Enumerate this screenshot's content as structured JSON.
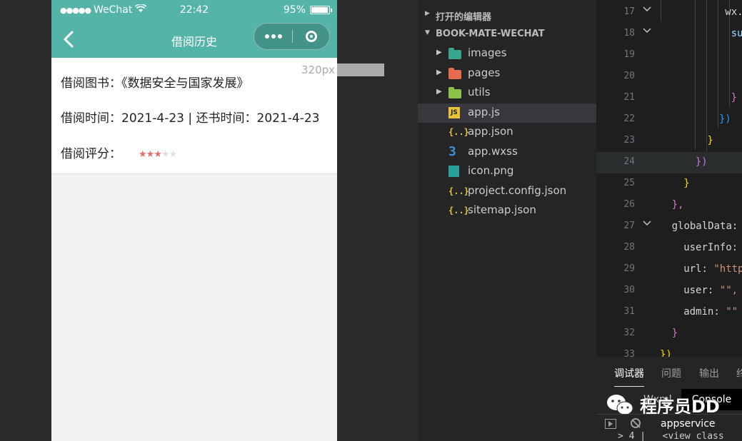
{
  "simulator": {
    "status_bar": {
      "signal": "●●●●●",
      "carrier": "WeChat",
      "time": "22:42",
      "battery_text": "95%",
      "battery_level": 0.95
    },
    "nav": {
      "title": "借阅历史"
    },
    "record": {
      "book_line": "借阅图书：《数据安全与国家发展》",
      "time_line": "借阅时间：2021-4-23 | 还书时间：2021-4-23",
      "rating_label": "借阅评分：",
      "rating": 3,
      "rating_max": 5
    },
    "size_hint": "320px × 504px",
    "colors": {
      "nav_bg": "#54b4a7",
      "star_on": "#e0706f",
      "star_off": "#dedede"
    }
  },
  "explorer": {
    "sections": [
      {
        "label": "打开的编辑器",
        "expanded": false
      },
      {
        "label": "BOOK-MATE-WECHAT",
        "expanded": true
      }
    ],
    "items": [
      {
        "name": "images",
        "type": "folder",
        "icon": "folder-images-icon",
        "color": "#3aa58f"
      },
      {
        "name": "pages",
        "type": "folder",
        "icon": "folder-pages-icon",
        "color": "#e56b4f"
      },
      {
        "name": "utils",
        "type": "folder",
        "icon": "folder-utils-icon",
        "color": "#8bc34a"
      },
      {
        "name": "app.js",
        "type": "js",
        "icon": "js-file-icon",
        "badge": "JS",
        "selected": true
      },
      {
        "name": "app.json",
        "type": "json",
        "icon": "json-file-icon",
        "badge": "{..}"
      },
      {
        "name": "app.wxss",
        "type": "css",
        "icon": "css-file-icon",
        "badge": "3"
      },
      {
        "name": "icon.png",
        "type": "png",
        "icon": "image-file-icon"
      },
      {
        "name": "project.config.json",
        "type": "json",
        "icon": "json-file-icon",
        "badge": "{..}"
      },
      {
        "name": "sitemap.json",
        "type": "json",
        "icon": "json-file-icon",
        "badge": "{..}"
      }
    ]
  },
  "editor": {
    "lines": [
      {
        "n": "17",
        "fold": true,
        "indent": 11,
        "tokens": [
          [
            "wx.g",
            "#d4d4d4"
          ]
        ]
      },
      {
        "n": "18",
        "fold": true,
        "indent": 12,
        "tokens": [
          [
            "su",
            "#9cdcfe"
          ]
        ]
      },
      {
        "n": "19",
        "fold": false,
        "indent": 0,
        "tokens": []
      },
      {
        "n": "20",
        "fold": false,
        "indent": 0,
        "tokens": []
      },
      {
        "n": "21",
        "fold": false,
        "indent": 12,
        "tokens": [
          [
            "}",
            "#da70d6"
          ]
        ]
      },
      {
        "n": "22",
        "fold": false,
        "indent": 10,
        "tokens": [
          [
            "})",
            "#179fff"
          ]
        ]
      },
      {
        "n": "23",
        "fold": false,
        "indent": 8,
        "tokens": [
          [
            "}",
            "#ffd700"
          ]
        ]
      },
      {
        "n": "24",
        "fold": false,
        "indent": 6,
        "tokens": [
          [
            "})",
            "#da70d6"
          ]
        ],
        "highlight": true
      },
      {
        "n": "25",
        "fold": false,
        "indent": 4,
        "tokens": [
          [
            "}",
            "#ffd700"
          ]
        ]
      },
      {
        "n": "26",
        "fold": false,
        "indent": 2,
        "tokens": [
          [
            "},",
            "#da70d6"
          ]
        ]
      },
      {
        "n": "27",
        "fold": true,
        "indent": 2,
        "tokens": [
          [
            "globalData: ",
            "#d4d4d4"
          ]
        ]
      },
      {
        "n": "28",
        "fold": false,
        "indent": 4,
        "tokens": [
          [
            "userInfo: ",
            "#d4d4d4"
          ]
        ]
      },
      {
        "n": "29",
        "fold": false,
        "indent": 4,
        "tokens": [
          [
            "url: ",
            "#d4d4d4"
          ],
          [
            "\"http",
            "#ce9178"
          ]
        ]
      },
      {
        "n": "30",
        "fold": false,
        "indent": 4,
        "tokens": [
          [
            "user: ",
            "#d4d4d4"
          ],
          [
            "\"\",",
            "#ce9178"
          ]
        ]
      },
      {
        "n": "31",
        "fold": false,
        "indent": 4,
        "tokens": [
          [
            "admin: ",
            "#d4d4d4"
          ],
          [
            "\"\"",
            "#ce9178"
          ]
        ]
      },
      {
        "n": "32",
        "fold": false,
        "indent": 2,
        "tokens": [
          [
            "}",
            "#da70d6"
          ]
        ]
      },
      {
        "n": "33",
        "fold": false,
        "indent": 0,
        "tokens": [
          [
            "})",
            "#ffd700"
          ]
        ]
      }
    ]
  },
  "debug": {
    "tabs": [
      "调试器",
      "问题",
      "输出",
      "终"
    ],
    "active_tab": "调试器",
    "subtabs": {
      "wxml": "Wxml",
      "console": "Console"
    },
    "watermark": "程序员DD",
    "context": "appservice",
    "bottom_line": "> 4 |   <view class"
  }
}
